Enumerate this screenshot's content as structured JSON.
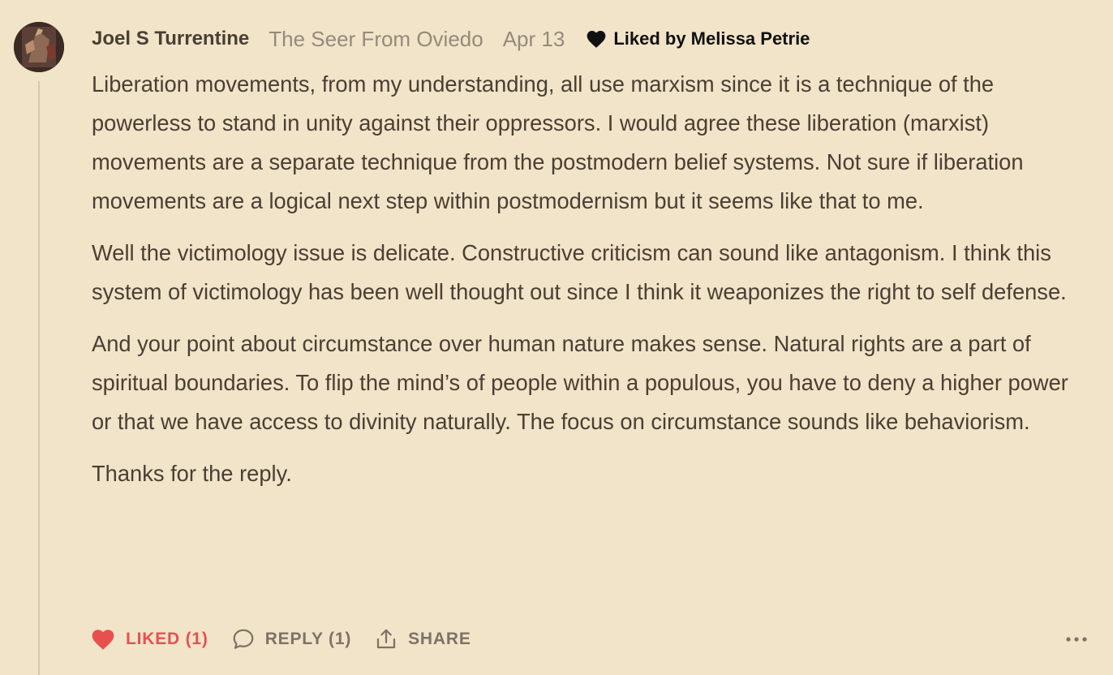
{
  "comment": {
    "author": "Joel S Turrentine",
    "author_title": "The Seer From Oviedo",
    "date": "Apr 13",
    "liked_by": "Liked by Melissa Petrie",
    "paragraphs": [
      "Liberation movements, from my understanding, all use marxism since it is a technique of the powerless to stand in unity against their oppressors. I would agree these liberation (marxist) movements are a separate technique from the postmodern belief systems. Not sure if liberation movements are a logical next step within postmodernism but it seems like that to me.",
      "Well the victimology issue is delicate. Constructive criticism can sound like antagonism. I think this system of victimology has been well thought out since I think it weaponizes the right to self defense.",
      "And your point about circumstance over human nature makes sense. Natural rights are a part of spiritual boundaries. To flip the mind’s of people within a populous, you have to deny a higher power or that we have access to divinity naturally. The focus on circumstance sounds like behaviorism.",
      "Thanks for the reply."
    ],
    "actions": {
      "like_label": "LIKED (1)",
      "reply_label": "REPLY (1)",
      "share_label": "SHARE"
    }
  },
  "colors": {
    "background": "#f1e4c9",
    "text": "#4a3f33",
    "muted": "#958a7b",
    "liked": "#e8504f",
    "action": "#7c7367",
    "thread_line": "#d9c8a8"
  },
  "icons": {
    "liked_by": "heart-filled-icon",
    "like": "heart-filled-icon",
    "reply": "speech-bubble-icon",
    "share": "share-upload-icon",
    "more": "ellipsis-icon"
  }
}
